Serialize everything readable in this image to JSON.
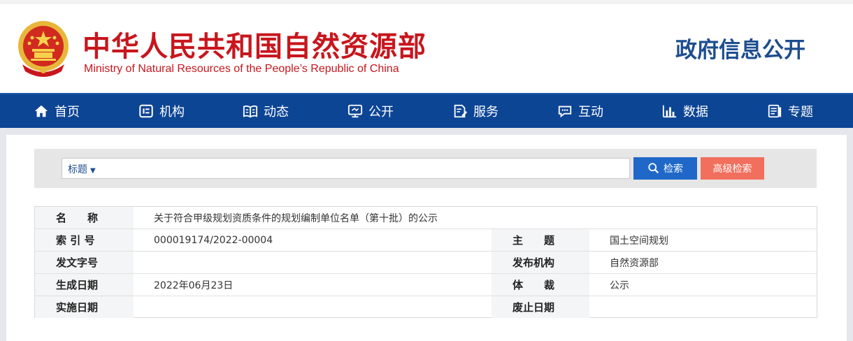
{
  "header": {
    "title_cn": "中华人民共和国自然资源部",
    "title_en": "Ministry of Natural Resources of the People’s Republic of China",
    "gov_open": "政府信息公开"
  },
  "nav": {
    "items": [
      {
        "label": "首页",
        "icon": "home-icon"
      },
      {
        "label": "机构",
        "icon": "organization-icon"
      },
      {
        "label": "动态",
        "icon": "book-icon"
      },
      {
        "label": "公开",
        "icon": "monitor-icon"
      },
      {
        "label": "服务",
        "icon": "edit-document-icon"
      },
      {
        "label": "互动",
        "icon": "chat-bubble-icon"
      },
      {
        "label": "数据",
        "icon": "bar-chart-icon"
      },
      {
        "label": "专题",
        "icon": "topic-document-icon"
      }
    ]
  },
  "search": {
    "type_label": "标题",
    "search_button": "检索",
    "advanced_button": "高级检索"
  },
  "info": {
    "name_label": "名　　称",
    "name_value": "关于符合甲级规划资质条件的规划编制单位名单（第十批）的公示",
    "index_label": "索 引 号",
    "index_value": "000019174/2022-00004",
    "topic_label": "主　　题",
    "topic_value": "国土空间规划",
    "doc_no_label": "发文字号",
    "doc_no_value": "",
    "issuer_label": "发布机构",
    "issuer_value": "自然资源部",
    "created_label": "生成日期",
    "created_value": "2022年06月23日",
    "genre_label": "体　　裁",
    "genre_value": "公示",
    "effective_label": "实施日期",
    "effective_value": "",
    "expiry_label": "废止日期",
    "expiry_value": ""
  },
  "colors": {
    "brand_red": "#c8161d",
    "nav_blue": "#0d4595",
    "search_blue": "#1f68c8",
    "advanced_coral": "#f26f5d"
  }
}
